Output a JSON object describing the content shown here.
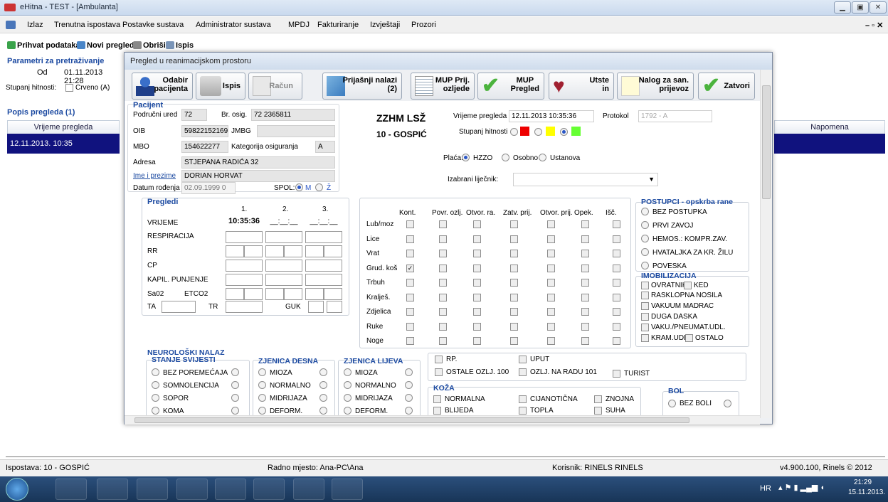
{
  "window": {
    "title": "eHitna - TEST - [Ambulanta]"
  },
  "menu": [
    "Izlaz",
    "Trenutna ispostava",
    "Postavke sustava",
    "Administrator sustava",
    "MPDJ",
    "Fakturiranje",
    "Izvještaji",
    "Prozori"
  ],
  "toolbar": [
    "Prihvat podataka",
    "Novi pregled",
    "Obriši",
    "Ispis"
  ],
  "left": {
    "params_title": "Parametri za pretraživanje",
    "od_label": "Od",
    "od_value": "01.11.2013 21:28",
    "hitnost_label": "Stupanj hitnosti:",
    "crveno": "Crveno (A)",
    "popis": "Popis pregleda (1)",
    "col": "Vrijeme pregleda",
    "row": "12.11.2013. 10:35"
  },
  "right": {
    "col": "Napomena"
  },
  "modal": {
    "title": "Pregled u reanimacijskom prostoru",
    "buttons": [
      "Odabir\npacijenta",
      "Ispis",
      "Račun",
      "Prijašnji nalazi\n(2)",
      "MUP Prij.\nozljede",
      "MUP\nPregled",
      "Utste\nin",
      "Nalog za san.\nprijevoz",
      "Zatvori"
    ],
    "pacijent": {
      "title": "Pacijent",
      "podrucni_ured_l": "Područni ured",
      "podrucni_ured": "72",
      "br_osig_l": "Br. osig.",
      "br_osig": "72 2365811",
      "oib_l": "OIB",
      "oib": "59822152169",
      "jmbg_l": "JMBG",
      "mbo_l": "MBO",
      "mbo": "154622277",
      "kat_l": "Kategorija osiguranja",
      "kat": "A",
      "adresa_l": "Adresa",
      "adresa": "STJEPANA RADIĆA 32",
      "ime_l": "Ime i prezime",
      "ime": "DORIAN HORVAT",
      "datum_l": "Datum rođenja",
      "datum": "02.09.1999 0",
      "spol_l": "SPOL:",
      "m": "M",
      "z": "Ž"
    },
    "header": {
      "zzhm": "ZZHM LSŽ",
      "grad": "10 - GOSPIĆ",
      "vrijeme_l": "Vrijeme pregleda",
      "vrijeme": "12.11.2013 10:35:36",
      "protokol_l": "Protokol",
      "protokol": "1792 - A",
      "hitnost_l": "Stupanj hitnosti",
      "placa_l": "Plaća:",
      "hzzo": "HZZO",
      "osobno": "Osobno",
      "ustanova": "Ustanova",
      "ljecnik_l": "Izabrani liječnik:"
    },
    "pregledi": {
      "title": "Pregledi",
      "cols": [
        "1.",
        "2.",
        "3."
      ],
      "rows": [
        "VRIJEME",
        "RESPIRACIJA",
        "RR",
        "CP",
        "KAPIL. PUNJENJE",
        "Sa02",
        "ETCO2",
        "TA",
        "TR",
        "GUK"
      ],
      "vrijeme1": "10:35:36",
      "vrijeme_blank": "__:__:__"
    },
    "ozljede": {
      "cols": [
        "Kont.",
        "Povr. ozlj.",
        "Otvor. ra.",
        "Zatv. prij.",
        "Otvor. prij.",
        "Opek.",
        "Išč."
      ],
      "rows": [
        "Lub/moz",
        "Lice",
        "Vrat",
        "Grud. koš",
        "Trbuh",
        "Kralješ.",
        "Zdjelica",
        "Ruke",
        "Noge"
      ]
    },
    "postupci": {
      "title": "POSTUPCI - opskrba rane",
      "items": [
        "BEZ POSTUPKA",
        "PRVI ZAVOJ",
        "HEMOS.: KOMPR.ZAV.",
        "HVATALJKA ZA KR. ŽILU",
        "POVESKA"
      ]
    },
    "imob": {
      "title": "IMOBILIZACIJA",
      "items": [
        "OVRATNIK",
        "KED",
        "RASKLOPNA NOSILA",
        "VAKUUM MADRAC",
        "DUGA DASKA",
        "VAKU./PNEUMAT.UDL.",
        "KRAM.UDL.",
        "OSTALO"
      ]
    },
    "neuro": {
      "title": "NEUROLOŠKI NALAZ",
      "svijest_t": "STANJE SVIJESTI",
      "svijest": [
        "BEZ POREMEĆAJA",
        "SOMNOLENCIJA",
        "SOPOR",
        "KOMA"
      ],
      "desna_t": "ZJENICA DESNA",
      "lijeva_t": "ZJENICA LIJEVA",
      "zjenica": [
        "MIOZA",
        "NORMALNO",
        "MIDRIJAZA",
        "DEFORM."
      ]
    },
    "ostalo": [
      "RP.",
      "UPUT",
      "OSTALE OZLJ. 100",
      "OZLJ. NA RADU 101",
      "TURIST"
    ],
    "koza": {
      "title": "KOŽA",
      "items": [
        "NORMALNA",
        "CIJANOTIČNA",
        "ZNOJNA",
        "BLIJEDA",
        "TOPLA",
        "SUHA"
      ]
    },
    "bol": {
      "title": "BOL",
      "items": [
        "BEZ BOLI"
      ]
    }
  },
  "status": {
    "ispostava": "Ispostava: 10 - GOSPIĆ",
    "radno": "Radno mjesto: Ana-PC\\Ana",
    "korisnik": "Korisnik: RINELS RINELS",
    "verzija": "v4.900.100, Rinels © 2012"
  },
  "tray": {
    "lang": "HR",
    "time": "21:29",
    "date": "15.11.2013."
  }
}
